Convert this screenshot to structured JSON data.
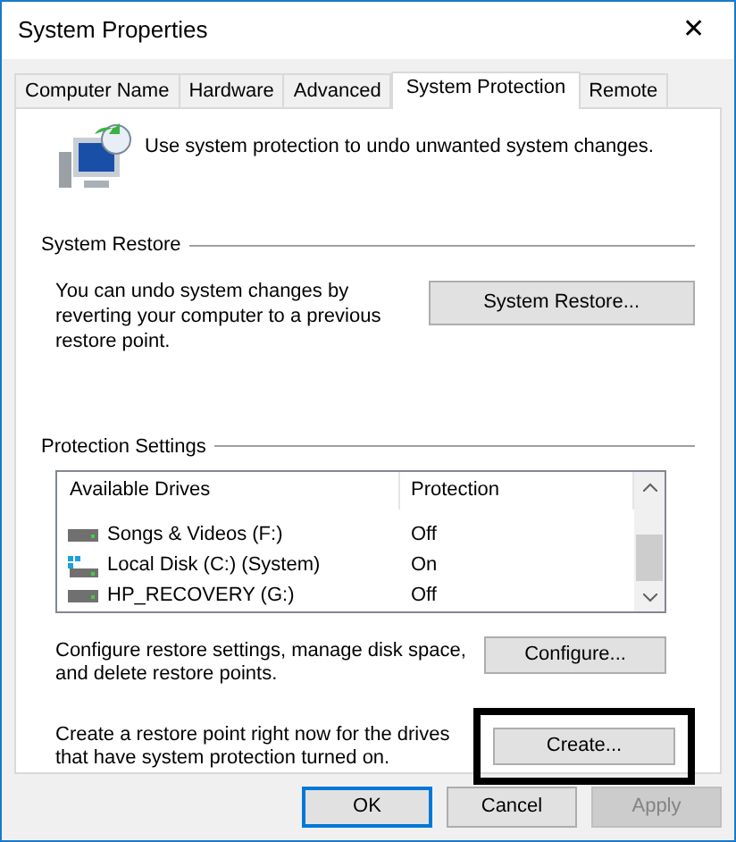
{
  "window": {
    "title": "System Properties",
    "close": "✕"
  },
  "tabs": [
    {
      "label": "Computer Name",
      "selected": false
    },
    {
      "label": "Hardware",
      "selected": false
    },
    {
      "label": "Advanced",
      "selected": false
    },
    {
      "label": "System Protection",
      "selected": true
    },
    {
      "label": "Remote",
      "selected": false
    }
  ],
  "intro": "Use system protection to undo unwanted system changes.",
  "system_restore": {
    "label": "System Restore",
    "description": "You can undo system changes by reverting your computer to a previous restore point.",
    "button": "System Restore..."
  },
  "protection_settings": {
    "label": "Protection Settings",
    "columns": [
      "Available Drives",
      "Protection"
    ],
    "drives": [
      {
        "name": "Songs & Videos (F:)",
        "protection": "Off",
        "kind": "drive"
      },
      {
        "name": "Local Disk (C:) (System)",
        "protection": "On",
        "kind": "system"
      },
      {
        "name": "HP_RECOVERY (G:)",
        "protection": "Off",
        "kind": "drive"
      }
    ]
  },
  "configure": {
    "description": "Configure restore settings, manage disk space, and delete restore points.",
    "button": "Configure..."
  },
  "create": {
    "description": "Create a restore point right now for the drives that have system protection turned on.",
    "button": "Create...",
    "highlighted": true
  },
  "buttons": [
    {
      "label": "OK",
      "default": true,
      "disabled": false
    },
    {
      "label": "Cancel",
      "default": false,
      "disabled": false
    },
    {
      "label": "Apply",
      "default": false,
      "disabled": true
    }
  ]
}
